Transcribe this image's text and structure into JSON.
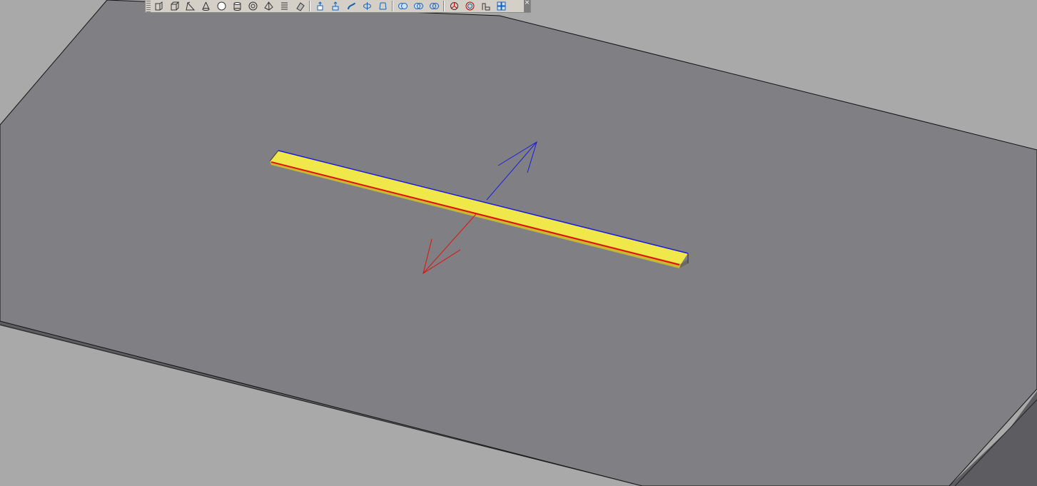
{
  "viewport": {
    "background_color": "#a9a9a9",
    "plane_color": "#808084",
    "solid_color": "#f0e84a"
  },
  "ucs": {
    "x_axis_color": "#e01010",
    "y_axis_color": "#1c1cdc"
  },
  "toolbar": {
    "groups": [
      [
        "polysolid-icon",
        "box-icon",
        "wedge-icon",
        "cone-icon",
        "sphere-icon",
        "cylinder-icon",
        "torus-icon",
        "pyramid-icon",
        "helix-icon",
        "planar-surface-icon"
      ],
      [
        "extrude-icon",
        "presspull-icon",
        "sweep-icon",
        "revolve-icon",
        "loft-icon"
      ],
      [
        "union-icon",
        "subtract-icon",
        "intersect-icon"
      ],
      [
        "3d-move-icon",
        "3d-rotate-icon",
        "3d-align-icon",
        "3d-array-icon"
      ]
    ],
    "close_glyph": "×"
  }
}
